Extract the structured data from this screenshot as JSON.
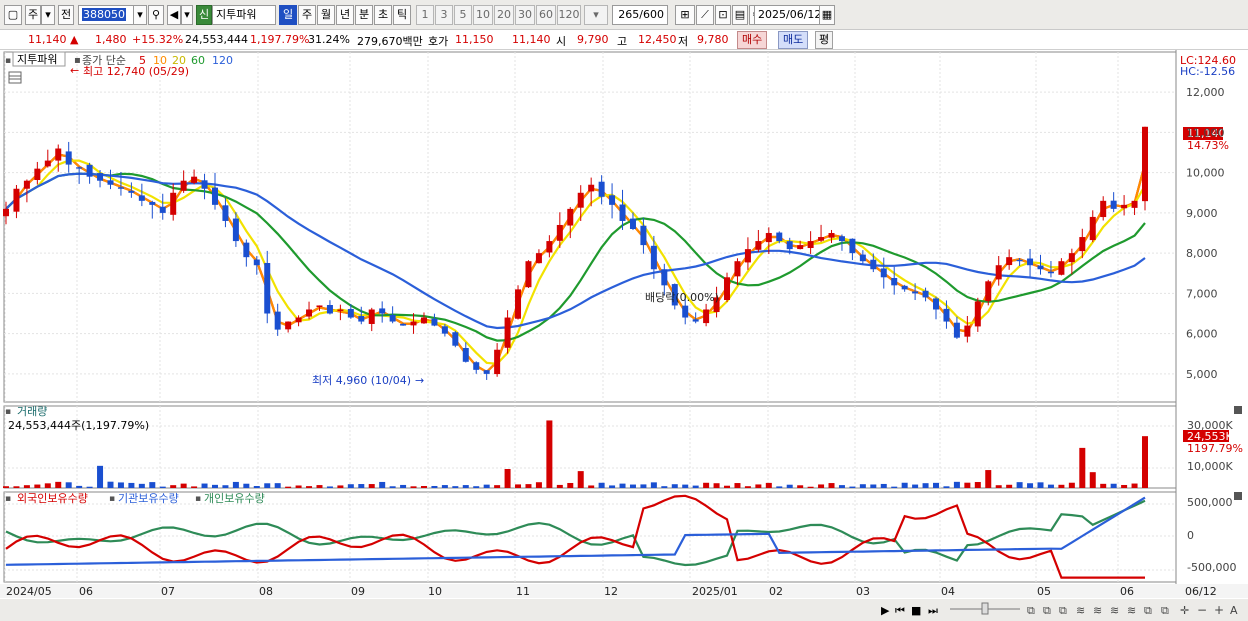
{
  "toolbar": {
    "period_box": "주",
    "mode_box": "전",
    "code": "388050",
    "sin_badge": "신",
    "stock_name": "지투파워",
    "intervals": [
      "일",
      "주",
      "월",
      "년",
      "분",
      "초",
      "틱"
    ],
    "selected_interval": "일",
    "minute_options": [
      "1",
      "3",
      "5",
      "10",
      "20",
      "30",
      "60",
      "120"
    ],
    "count": "265",
    "count_total": "/600",
    "date": "2025/06/12"
  },
  "infobar": {
    "price": "11,140",
    "change": "1,480",
    "change_pct": "+15.32%",
    "volume": "24,553,444",
    "volume_pct": "1,197.79%",
    "turnover": "31.24%",
    "amount": "279,670백만",
    "quote_label": "호가",
    "ask": "11,150",
    "bid": "11,140",
    "open_label": "시",
    "open": "9,790",
    "high_label": "고",
    "high": "12,450",
    "low_label": "저",
    "low": "9,780",
    "buy_label": "매수",
    "sell_label": "매도",
    "avg_label": "평"
  },
  "price_panel": {
    "stock_label": "지투파워",
    "ma_title": "종가 단순",
    "ma_periods": [
      {
        "label": "5",
        "color": "#d40000"
      },
      {
        "label": "10",
        "color": "#ff8c00"
      },
      {
        "label": "20",
        "color": "#e8d800"
      },
      {
        "label": "60",
        "color": "#1f9a2e"
      },
      {
        "label": "120",
        "color": "#2b5fd9"
      }
    ],
    "high_marker": "최고 12,740 (05/29)",
    "low_marker": "최저 4,960 (10/04)",
    "annotation": "배당락(0.00%)",
    "lc_label": "LC:124.60",
    "hc_label": "HC:-12.56",
    "current_price_tag": "11,140",
    "current_pct_tag": "14.73%",
    "y_ticks": [
      "12,000",
      "11,000",
      "10,000",
      "9,000",
      "8,000",
      "7,000",
      "6,000",
      "5,000"
    ]
  },
  "volume_panel": {
    "title": "거래량",
    "value_label": "24,553,444주(1,197.79%)",
    "y_ticks": [
      "30,000K",
      "10,000K"
    ],
    "current_tag": "24,553K",
    "current_pct_tag": "1197.79%"
  },
  "holdings_panel": {
    "series_labels": [
      "외국인보유수량",
      "기관보유수량",
      "개인보유수량"
    ],
    "series_colors": [
      "#d40000",
      "#2b5fd9",
      "#2e8b57"
    ],
    "y_ticks": [
      "500,000",
      "0",
      "-500,000"
    ]
  },
  "x_axis": {
    "labels": [
      "2024/05",
      "06",
      "07",
      "08",
      "09",
      "10",
      "11",
      "12",
      "2025/01",
      "02",
      "03",
      "04",
      "05",
      "06",
      "06/12"
    ]
  },
  "chart_data": {
    "type": "candlestick",
    "y_range": [
      4500,
      12700
    ],
    "key_points": [
      {
        "date": "05/29",
        "label": "최고",
        "value": 12740
      },
      {
        "date": "10/04",
        "label": "최저",
        "value": 4960
      }
    ],
    "closes": [
      9100,
      9600,
      9800,
      10100,
      10300,
      10600,
      10200,
      10100,
      9900,
      9800,
      9700,
      9600,
      9500,
      9300,
      9200,
      9000,
      9500,
      9800,
      9900,
      9600,
      9200,
      8800,
      8300,
      7900,
      7700,
      6500,
      6100,
      6300,
      6400,
      6600,
      6700,
      6500,
      6600,
      6400,
      6300,
      6600,
      6500,
      6300,
      6200,
      6300,
      6400,
      6200,
      6000,
      5700,
      5300,
      5100,
      5000,
      5600,
      6400,
      7100,
      7800,
      8000,
      8300,
      8700,
      9100,
      9500,
      9700,
      9400,
      9200,
      8800,
      8600,
      8200,
      7600,
      7200,
      6700,
      6400,
      6300,
      6600,
      6900,
      7400,
      7800,
      8100,
      8300,
      8500,
      8300,
      8100,
      8200,
      8300,
      8400,
      8500,
      8300,
      8000,
      7800,
      7600,
      7400,
      7200,
      7100,
      7000,
      6900,
      6600,
      6300,
      5900,
      6200,
      6800,
      7300,
      7700,
      7900,
      7800,
      7700,
      7600,
      7500,
      7800,
      8000,
      8400,
      8900,
      9300,
      9100,
      9200,
      9300,
      11140
    ],
    "volume_spikes": [
      {
        "month": "06",
        "approx_k": 10000
      },
      {
        "month": "10-11",
        "approx_k": 32000
      },
      {
        "month": "06",
        "approx_k": 24553
      }
    ]
  }
}
